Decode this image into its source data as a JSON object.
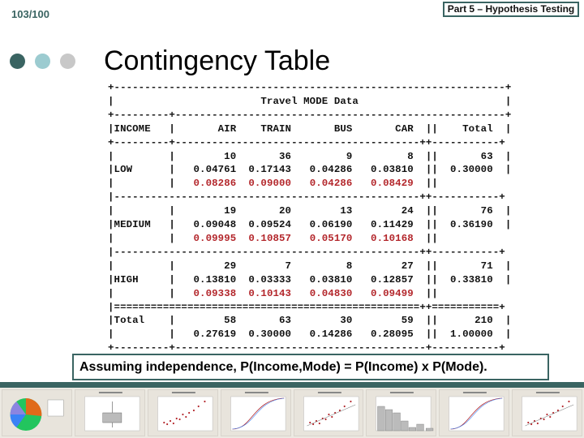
{
  "header": {
    "slide_number": "103/100",
    "section_label": "Part 5 – Hypothesis Testing",
    "title": "Contingency Table",
    "dot_colors": [
      "#3a6462",
      "#9ccbd0",
      "#c8c8c8"
    ]
  },
  "table": {
    "caption": "Travel MODE Data",
    "row_header": "INCOME",
    "columns": [
      "AIR",
      "TRAIN",
      "BUS",
      "CAR"
    ],
    "total_label": "Total",
    "rows": [
      {
        "label": "LOW",
        "counts": [
          "10",
          "36",
          "9",
          "8"
        ],
        "total": "63",
        "joint": [
          "0.04761",
          "0.17143",
          "0.04286",
          "0.03810"
        ],
        "total_prop": "0.30000",
        "expected": [
          "0.08286",
          "0.09000",
          "0.04286",
          "0.08429"
        ]
      },
      {
        "label": "MEDIUM",
        "counts": [
          "19",
          "20",
          "13",
          "24"
        ],
        "total": "76",
        "joint": [
          "0.09048",
          "0.09524",
          "0.06190",
          "0.11429"
        ],
        "total_prop": "0.36190",
        "expected": [
          "0.09995",
          "0.10857",
          "0.05170",
          "0.10168"
        ]
      },
      {
        "label": "HIGH",
        "counts": [
          "29",
          "7",
          "8",
          "27"
        ],
        "total": "71",
        "joint": [
          "0.13810",
          "0.03333",
          "0.03810",
          "0.12857"
        ],
        "total_prop": "0.33810",
        "expected": [
          "0.09338",
          "0.10143",
          "0.04830",
          "0.09499"
        ]
      }
    ],
    "totals": {
      "label": "Total",
      "counts": [
        "58",
        "63",
        "30",
        "59"
      ],
      "total": "210",
      "props": [
        "0.27619",
        "0.30000",
        "0.14286",
        "0.28095"
      ],
      "total_prop": "1.00000"
    },
    "expected_color": "#b3262b"
  },
  "footnote": "Assuming independence, P(Income,Mode) = P(Income) x P(Mode).",
  "thumbnail_strip": {
    "items": [
      "pie-chart",
      "boxplot",
      "scatterplot",
      "probability-plot",
      "scatterplot-with-fit",
      "histogram",
      "empirical-cdf",
      "marginal-plot"
    ]
  },
  "colors": {
    "accent": "#3a6462"
  }
}
